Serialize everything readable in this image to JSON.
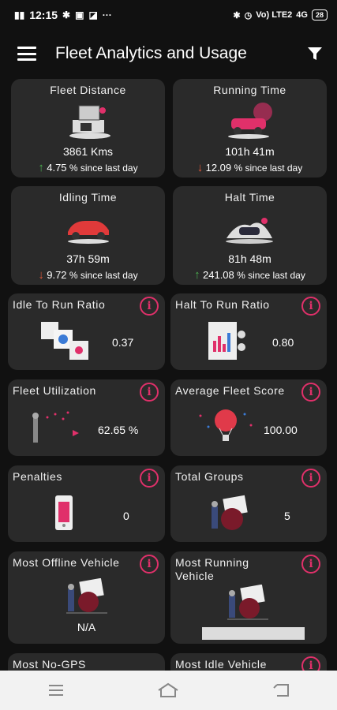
{
  "status_bar": {
    "time": "12:15",
    "left_icons": [
      "signal-icon",
      "wifi-icon",
      "app-notification-icon",
      "chat-icon",
      "more-icon"
    ],
    "right_text": "Vo) LTE2",
    "network": "4G",
    "battery": "28"
  },
  "app_bar": {
    "title": "Fleet Analytics and Usage"
  },
  "top_cards": [
    {
      "title": "Fleet Distance",
      "value": "3861 Kms",
      "trend": "up",
      "percent": "4.75",
      "since": "% since last day"
    },
    {
      "title": "Running Time",
      "value": "101h 41m",
      "trend": "down",
      "percent": "12.09",
      "since": "% since last day"
    },
    {
      "title": "Idling Time",
      "value": "37h 59m",
      "trend": "down",
      "percent": "9.72",
      "since": "% since last day"
    },
    {
      "title": "Halt Time",
      "value": "81h 48m",
      "trend": "up",
      "percent": "241.08",
      "since": "% since last day"
    }
  ],
  "small_cards": [
    {
      "title": "Idle To Run Ratio",
      "value": "0.37"
    },
    {
      "title": "Halt To Run Ratio",
      "value": "0.80"
    },
    {
      "title": "Fleet Utilization",
      "value": "62.65 %"
    },
    {
      "title": "Average Fleet Score",
      "value": "100.00"
    },
    {
      "title": "Penalties",
      "value": "0"
    },
    {
      "title": "Total Groups",
      "value": "5"
    },
    {
      "title": "Most Offline Vehicle",
      "value": "N/A"
    },
    {
      "title": "Most Running Vehicle",
      "value": ""
    },
    {
      "title": "Most No-GPS",
      "value": ""
    },
    {
      "title": "Most Idle Vehicle",
      "value": ""
    }
  ],
  "info_icon": "i",
  "colors": {
    "background": "#111111",
    "card": "#2a2a2a",
    "accent": "#e0306a",
    "up": "#4caf50",
    "down": "#e05a3a"
  }
}
